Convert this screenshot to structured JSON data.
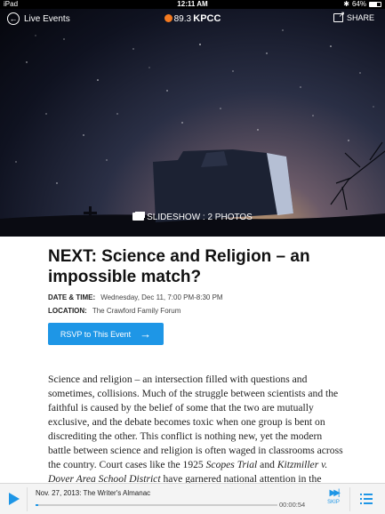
{
  "status_bar": {
    "carrier": "iPad",
    "time": "12:11 AM",
    "battery_text": "64%",
    "battery_level": 0.64
  },
  "nav": {
    "back_label": "Live Events",
    "logo_freq": "89.3",
    "logo_name": "KPCC",
    "share_label": "SHARE"
  },
  "hero": {
    "slideshow_label": "SLIDESHOW : 2 PHOTOS"
  },
  "event": {
    "title": "NEXT: Science and Religion – an impossible match?",
    "date_label": "DATE & TIME:",
    "date_value": "Wednesday, Dec 11, 7:00 PM-8:30 PM",
    "location_label": "LOCATION:",
    "location_value": "The Crawford Family Forum",
    "rsvp_label": "RSVP to This Event"
  },
  "body": {
    "p1a": "Science and religion – an intersection filled with questions and sometimes, collisions. Much of the struggle between scientists and the faithful is caused by the belief of some that the two are mutually exclusive, and the debate becomes toxic when one group is bent on discrediting the other.  This conflict is nothing new, yet the modern battle between science and religion is often waged in classrooms across the country. Court cases like the 1925 ",
    "p1_em1": "Scopes Trial",
    "p1b": " and ",
    "p1_em2": "Kitzmiller v. Dover Area School District",
    "p1c": " have garnered national attention in the debate about whether or not creationism has a"
  },
  "player": {
    "track_title": "Nov. 27, 2013: The Writer's Almanac",
    "time": "00:00:54",
    "skip_label": "SKIP",
    "progress": 0.01
  },
  "colors": {
    "accent": "#1e96e6",
    "logo_orange": "#f47a20"
  }
}
